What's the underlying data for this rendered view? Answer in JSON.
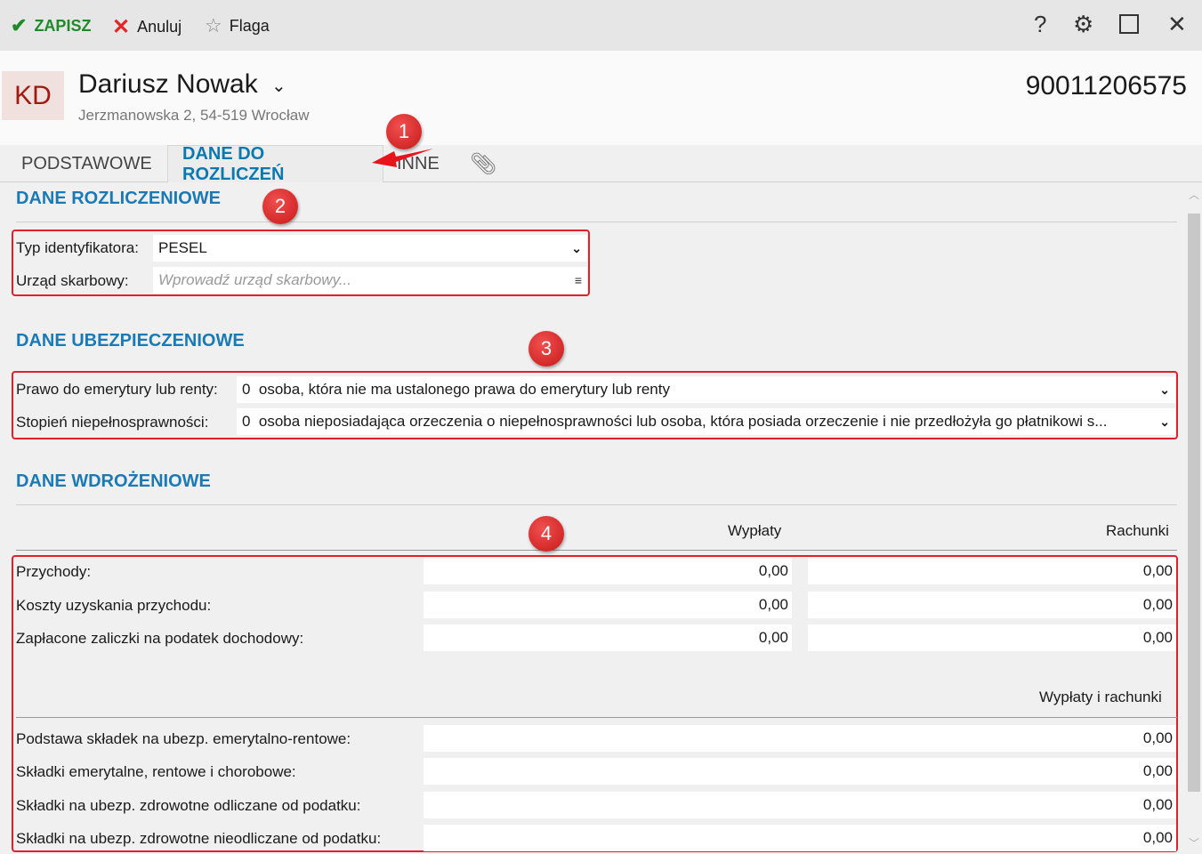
{
  "toolbar": {
    "save": "ZAPISZ",
    "cancel": "Anuluj",
    "flag": "Flaga"
  },
  "header": {
    "initials": "KD",
    "name": "Dariusz Nowak",
    "address": "Jerzmanowska 2, 54-519 Wrocław",
    "pesel": "90011206575"
  },
  "tabs": [
    "PODSTAWOWE",
    "DANE DO ROZLICZEŃ",
    "INNE"
  ],
  "billing": {
    "title": "DANE ROZLICZENIOWE",
    "id_type_label": "Typ identyfikatora:",
    "id_type_value": "PESEL",
    "tax_office_label": "Urząd skarbowy:",
    "tax_office_placeholder": "Wprowadź urząd skarbowy..."
  },
  "insurance": {
    "title": "DANE UBEZPIECZENIOWE",
    "pension_label": "Prawo do emerytury lub renty:",
    "pension_value": "0  osoba, która nie ma ustalonego prawa do emerytury lub renty",
    "disability_label": "Stopień niepełnosprawności:",
    "disability_value": "0  osoba nieposiadająca orzeczenia o niepełnosprawności lub osoba, która posiada orzeczenie i nie przedłożyła go płatnikowi s..."
  },
  "implementation": {
    "title": "DANE WDROŻENIOWE",
    "col1": "Wypłaty",
    "col2": "Rachunki",
    "rows": [
      {
        "label": "Przychody:",
        "v1": "0,00",
        "v2": "0,00"
      },
      {
        "label": "Koszty uzyskania przychodu:",
        "v1": "0,00",
        "v2": "0,00"
      },
      {
        "label": "Zapłacone zaliczki na podatek dochodowy:",
        "v1": "0,00",
        "v2": "0,00"
      }
    ],
    "col3": "Wypłaty i rachunki",
    "rows2": [
      {
        "label": "Podstawa składek na ubezp. emerytalno-rentowe:",
        "v": "0,00"
      },
      {
        "label": "Składki emerytalne, rentowe i chorobowe:",
        "v": "0,00"
      },
      {
        "label": "Składki na ubezp. zdrowotne odliczane od podatku:",
        "v": "0,00"
      },
      {
        "label": "Składki na ubezp. zdrowotne nieodliczane od podatku:",
        "v": "0,00"
      }
    ]
  },
  "annotations": [
    "1",
    "2",
    "3",
    "4"
  ]
}
